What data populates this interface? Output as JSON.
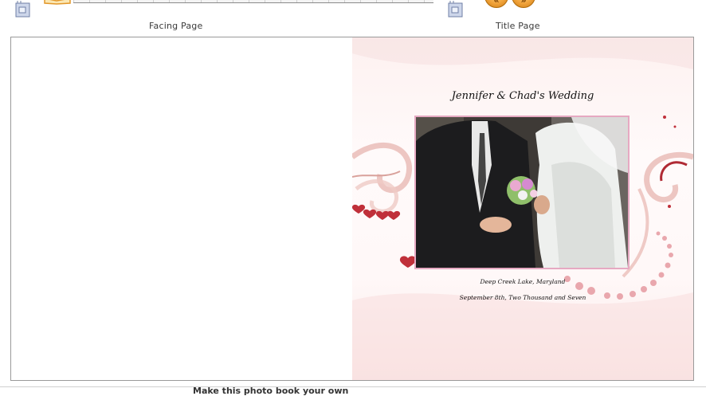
{
  "toolbar": {
    "facing_page_label": "Facing Page",
    "title_page_label": "Title Page",
    "prev_symbol": "«",
    "next_symbol": "»"
  },
  "title_page": {
    "title": "Jennifer & Chad's Wedding",
    "caption_line1": "Deep Creek Lake, Maryland",
    "caption_line2": "September 8th, Two Thousand and Seven"
  },
  "footer": {
    "make_book_label": "Make this photo book your own"
  },
  "colors": {
    "frame": "#e6a9c2",
    "heart": "#c0303a",
    "button": "#f0a23a"
  },
  "icons": [
    "page-icon",
    "book-icon",
    "prev-arrow-icon",
    "next-arrow-icon",
    "heart-icon"
  ]
}
